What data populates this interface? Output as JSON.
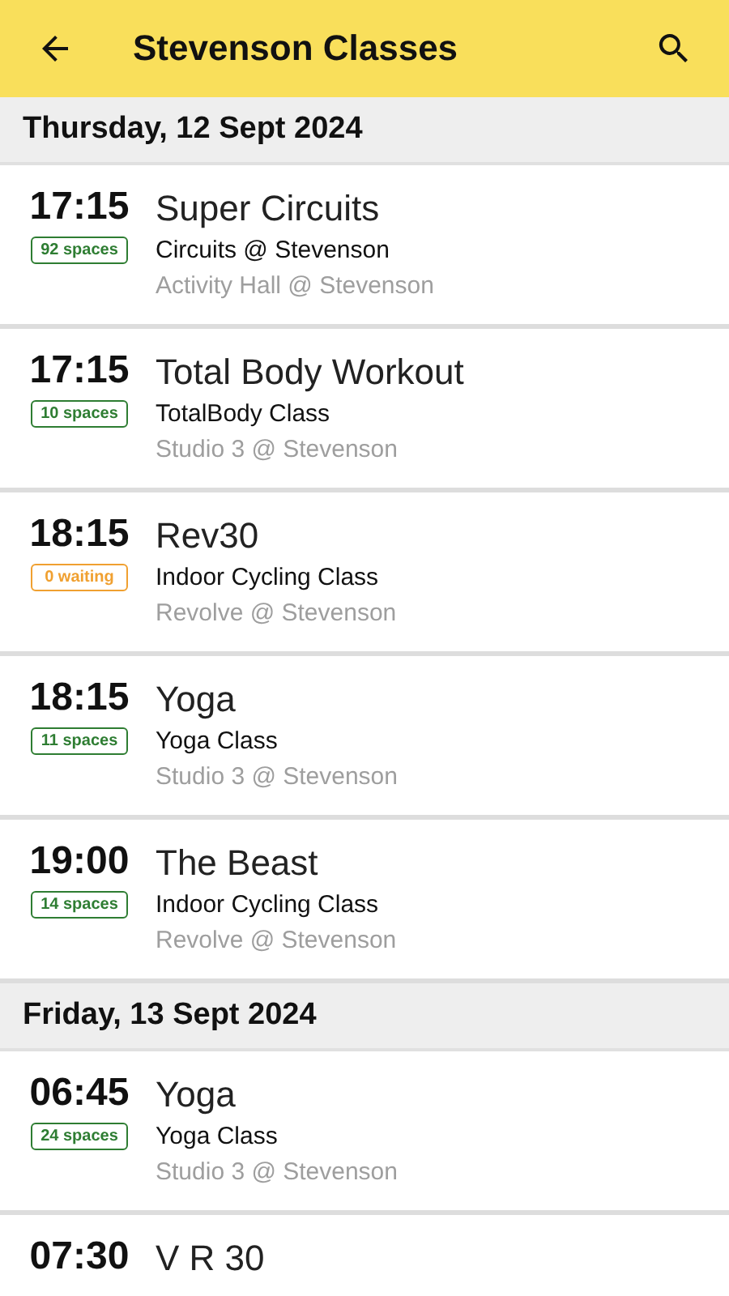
{
  "app_bar": {
    "title": "Stevenson Classes"
  },
  "days": [
    {
      "date": "Thursday, 12 Sept 2024",
      "classes": [
        {
          "time": "17:15",
          "badge": {
            "kind": "spaces",
            "text": "92 spaces"
          },
          "name": "Super Circuits",
          "type": "Circuits @ Stevenson",
          "location": "Activity Hall @ Stevenson"
        },
        {
          "time": "17:15",
          "badge": {
            "kind": "spaces",
            "text": "10 spaces"
          },
          "name": "Total Body Workout",
          "type": "TotalBody Class",
          "location": "Studio 3 @ Stevenson"
        },
        {
          "time": "18:15",
          "badge": {
            "kind": "waiting",
            "text": "0 waiting"
          },
          "name": "Rev30",
          "type": "Indoor Cycling Class",
          "location": "Revolve @ Stevenson"
        },
        {
          "time": "18:15",
          "badge": {
            "kind": "spaces",
            "text": "11 spaces"
          },
          "name": "Yoga",
          "type": "Yoga Class",
          "location": "Studio 3 @ Stevenson"
        },
        {
          "time": "19:00",
          "badge": {
            "kind": "spaces",
            "text": "14 spaces"
          },
          "name": "The Beast",
          "type": "Indoor Cycling Class",
          "location": "Revolve @ Stevenson"
        }
      ]
    },
    {
      "date": "Friday, 13 Sept 2024",
      "classes": [
        {
          "time": "06:45",
          "badge": {
            "kind": "spaces",
            "text": "24 spaces"
          },
          "name": "Yoga",
          "type": "Yoga Class",
          "location": "Studio 3 @ Stevenson"
        },
        {
          "time": "07:30",
          "name": "V R 30"
        }
      ]
    }
  ]
}
